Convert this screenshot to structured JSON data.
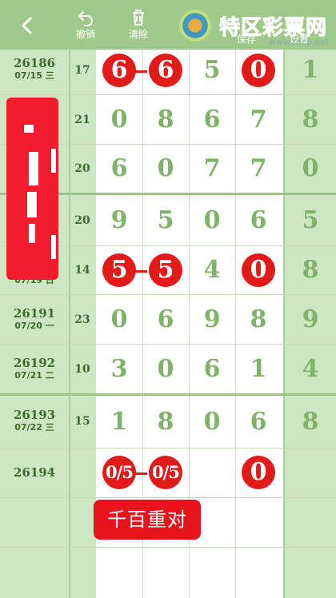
{
  "header": {
    "undo_label": "撤销",
    "clear_label": "清除",
    "save_label": "保存",
    "settings_label": "设置",
    "logo_text": "特区彩票网",
    "logo_url": "www.tqcp.net"
  },
  "rows": [
    {
      "issue": "26186",
      "date": "07/15 三",
      "count": "17",
      "digits": [
        "6",
        "6",
        "5",
        "0"
      ],
      "right": "1"
    },
    {
      "issue": "",
      "date": "",
      "count": "21",
      "digits": [
        "0",
        "8",
        "6",
        "7"
      ],
      "right": "8"
    },
    {
      "issue": "",
      "date": "",
      "count": "20",
      "digits": [
        "6",
        "0",
        "7",
        "7"
      ],
      "right": "0"
    },
    {
      "issue": "",
      "date": "",
      "count": "20",
      "digits": [
        "9",
        "5",
        "0",
        "6"
      ],
      "right": "5"
    },
    {
      "issue": "",
      "date": "07/19 日",
      "count": "14",
      "digits": [
        "5",
        "5",
        "4",
        "0"
      ],
      "right": "8"
    },
    {
      "issue": "26191",
      "date": "07/20 一",
      "count": "23",
      "digits": [
        "0",
        "6",
        "9",
        "8"
      ],
      "right": "9"
    },
    {
      "issue": "26192",
      "date": "07/21 二",
      "count": "10",
      "digits": [
        "3",
        "0",
        "6",
        "1"
      ],
      "right": "4"
    },
    {
      "issue": "26193",
      "date": "07/22 三",
      "count": "15",
      "digits": [
        "1",
        "8",
        "0",
        "6"
      ],
      "right": "8"
    },
    {
      "issue": "26194",
      "date": "",
      "count": "",
      "digits": [
        "0/5",
        "0/5",
        "",
        "0"
      ],
      "right": ""
    }
  ],
  "tag_label": "千百重对"
}
